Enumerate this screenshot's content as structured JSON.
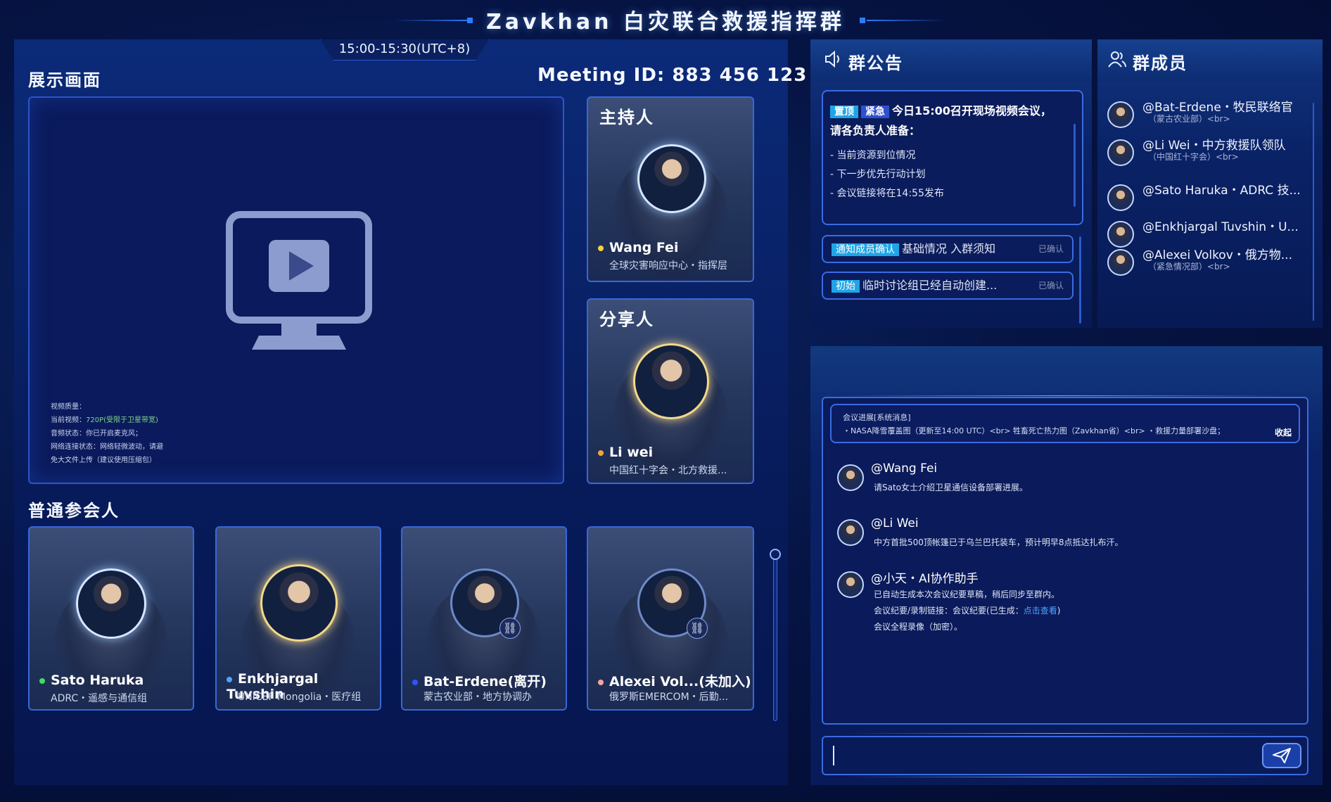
{
  "header": {
    "title": "Zavkhan 白灾联合救援指挥群"
  },
  "meeting": {
    "time": "15:00-15:30(UTC+8)",
    "id_label": "Meeting ID: 883 456 123",
    "display_label": "展示画面",
    "participants_label": "普通参会人",
    "video_info": {
      "quality_label": "视频质量：",
      "current_video_label": "当前视频：",
      "current_video_value": "720P(受限于卫星带宽)",
      "audio_label": "音频状态：",
      "audio_value": "你已开启麦克风；",
      "network_line1": "网络连接状态：网络轻微波动，请避",
      "network_line2": "免大文件上传（建议使用压缩包）"
    }
  },
  "host_card": {
    "role": "主持人",
    "name": "Wang Fei",
    "org": "全球灾害响应中心・指挥层",
    "status_color": "#f5d23b"
  },
  "sharer_card": {
    "role": "分享人",
    "name": "Li wei",
    "org": "中国红十字会・北方救援...",
    "status_color": "#f5a23b"
  },
  "participants": [
    {
      "name": "Sato Haruka",
      "org": "ADRC・遥感与通信组",
      "status_color": "#3be05a"
    },
    {
      "name": "Enkhjargal Tuvshin",
      "org": "UNICEF Mongolia・医疗组",
      "status_color": "#4ea4ff"
    },
    {
      "name": "Bat-Erdene(离开)",
      "org": "蒙古农业部・地方协调办",
      "status_color": "#2d55ff"
    },
    {
      "name": "Alexei Vol...(未加入)",
      "org": "俄罗斯EMERCOM・后勤...",
      "status_color": "#f5a3a3"
    }
  ],
  "notice": {
    "title": "群公告",
    "icon": "speaker-icon",
    "main": {
      "tag1": "置顶",
      "tag2": "紧急",
      "title_line1": "今日15:00召开现场视频会议，",
      "title_line2": "请各负责人准备：",
      "items": [
        "- 当前资源到位情况",
        "- 下一步优先行动计划",
        "- 会议链接将在14:55发布"
      ]
    },
    "items": [
      {
        "tag": "通知成员确认",
        "text": "基础情况 入群须知",
        "status": "已确认"
      },
      {
        "tag": "初始",
        "text": "临时讨论组已经自动创建...",
        "status": "已确认"
      }
    ]
  },
  "members": {
    "title": "群成员",
    "icon": "users-icon",
    "list": [
      {
        "name": "@Bat-Erdene・牧民联络官",
        "org": "（蒙古农业部）<br>"
      },
      {
        "name": "@Li Wei・中方救援队领队",
        "org": "（中国红十字会）<br>"
      },
      {
        "name": "@Sato Haruka・ADRC 技...",
        "org": ""
      },
      {
        "name": "@Enkhjargal Tuvshin・U...",
        "org": ""
      },
      {
        "name": "@Alexei Volkov・俄方物...",
        "org": "（紧急情况部）<br>"
      }
    ]
  },
  "chat": {
    "system": {
      "title": "会议进展[系统消息]",
      "body": "・NASA降雪覆盖图（更新至14:00 UTC）<br> 牲畜死亡热力图（Zavkhan省）<br> ・救援力量部署沙盘；",
      "collapse": "收起"
    },
    "messages": [
      {
        "name": "@Wang Fei",
        "lines": [
          "请Sato女士介绍卫星通信设备部署进展。"
        ]
      },
      {
        "name": "@Li Wei",
        "lines": [
          "中方首批500顶帐篷已于乌兰巴托装车，预计明早8点抵达扎布汗。"
        ]
      },
      {
        "name": "@小天・AI协作助手",
        "line1": "已自动生成本次会议纪要草稿，稍后同步至群内。",
        "line2_prefix": "会议纪要/录制链接：会议纪要(已生成：",
        "line2_link": "点击查看",
        "line2_suffix": ")",
        "line3": "会议全程录像（加密）。"
      }
    ],
    "input": {
      "value": ""
    }
  }
}
